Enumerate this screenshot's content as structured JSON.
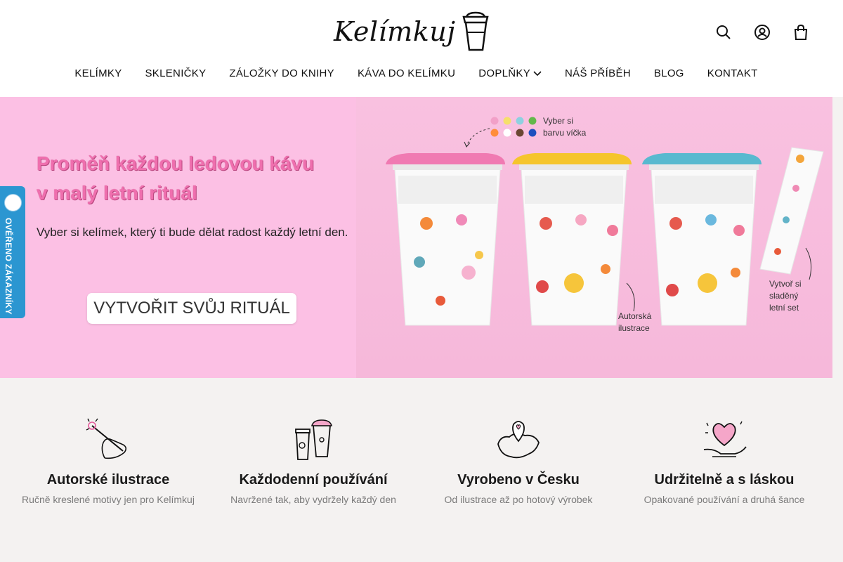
{
  "brand": {
    "name": "Kelímkuj"
  },
  "header_icons": [
    "search-icon",
    "account-icon",
    "cart-icon"
  ],
  "nav": {
    "items": [
      {
        "label": "KELÍMKY"
      },
      {
        "label": "SKLENIČKY"
      },
      {
        "label": "ZÁLOŽKY DO KNIHY"
      },
      {
        "label": "KÁVA DO KELÍMKU"
      },
      {
        "label": "DOPLŇKY"
      },
      {
        "label": "NÁŠ PŘÍBĚH"
      },
      {
        "label": "BLOG"
      },
      {
        "label": "KONTAKT"
      }
    ]
  },
  "hero": {
    "title_line1": "Proměň každou ledovou kávu",
    "title_line2": "v malý letní rituál",
    "subtitle": "Vyber si kelímek, který ti bude dělat radost každý letní den.",
    "cta": "VYTVOŘIT SVŮJ RITUÁL",
    "annotations": {
      "lid_color_1": "Vyber si",
      "lid_color_2": "barvu víčka",
      "illustration_1": "Autorská",
      "illustration_2": "ilustrace",
      "set_1": "Vytvoř si",
      "set_2": "sladěný",
      "set_3": "letní set"
    },
    "lid_swatches": [
      "#f2a0c8",
      "#f6df6b",
      "#8fd0e0",
      "#63b84b",
      "#ff8d3b",
      "#ffffff",
      "#6a4632",
      "#1e4fbf"
    ],
    "accent": "#ef6fae",
    "background": "#fcc0e4"
  },
  "badge": {
    "label": "OVĚŘENO ZÁKAZNÍKY",
    "color": "#2b96d1"
  },
  "features": [
    {
      "icon": "hand-drawing-icon",
      "title": "Autorské ilustrace",
      "text": "Ručně kreslené motivy jen pro Kelímkuj"
    },
    {
      "icon": "cups-icon",
      "title": "Každodenní používání",
      "text": "Navržené tak, aby vydržely každý den"
    },
    {
      "icon": "czech-map-pin-icon",
      "title": "Vyrobeno v Česku",
      "text": "Od ilustrace až po hotový výrobek"
    },
    {
      "icon": "heart-hands-icon",
      "title": "Udržitelně a s láskou",
      "text": "Opakované používání a druhá šance"
    }
  ]
}
